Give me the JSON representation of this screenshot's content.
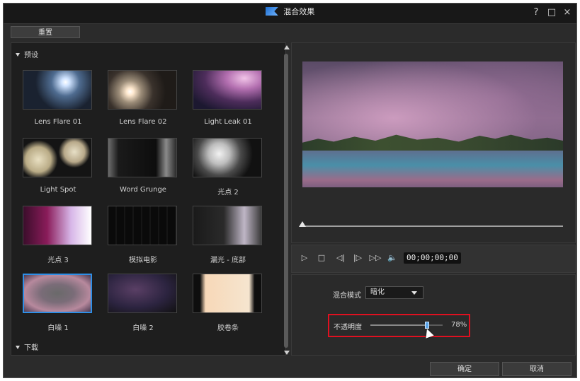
{
  "window": {
    "title": "混合效果",
    "help_icon": "?",
    "maximize_icon": "□",
    "close_icon": "×"
  },
  "toolbar": {
    "reset_label": "重置"
  },
  "library": {
    "sections": [
      {
        "label": "预设"
      },
      {
        "label": "下载"
      }
    ],
    "items": [
      {
        "label": "Lens Flare 01"
      },
      {
        "label": "Lens Flare 02"
      },
      {
        "label": "Light Leak 01"
      },
      {
        "label": "Light Spot"
      },
      {
        "label": "Word Grunge"
      },
      {
        "label": "光点 2"
      },
      {
        "label": "光点 3"
      },
      {
        "label": "模拟电影"
      },
      {
        "label": "漏光 - 底部"
      },
      {
        "label": "白噪 1"
      },
      {
        "label": "白噪 2"
      },
      {
        "label": "胶卷条"
      }
    ],
    "selected_index": 9
  },
  "player": {
    "timecode": "00;00;00;00",
    "position_fraction": 0,
    "controls": {
      "play": "▷",
      "stop": "□",
      "prev_frame": "◁|",
      "next_frame": "|▷",
      "fast_forward": "▷▷",
      "volume": "🔈"
    }
  },
  "settings": {
    "blend_mode_label": "混合模式",
    "blend_mode_value": "暗化",
    "opacity_label": "不透明度",
    "opacity_value": "78%",
    "opacity_fraction": 0.78
  },
  "footer": {
    "ok_label": "确定",
    "cancel_label": "取消"
  },
  "colors": {
    "accent_selected_border": "#2f8fe6",
    "highlight_box": "#e01020"
  }
}
